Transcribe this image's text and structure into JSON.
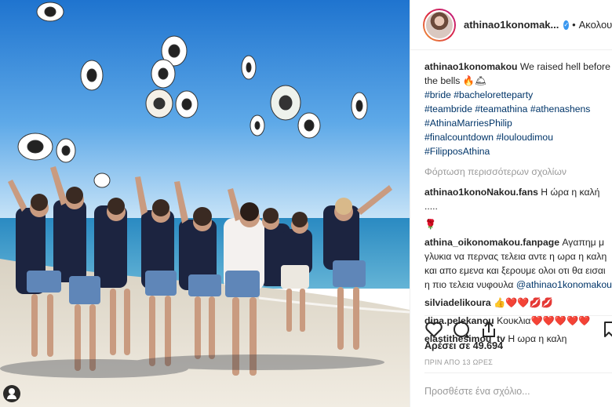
{
  "post": {
    "username": "athinao1konomak...",
    "follow_label": "Ακολουθε",
    "separator": "•",
    "verified_glyph": "✓"
  },
  "caption": {
    "username": "athinao1konomakou",
    "text": " We raised hell before the bells 🔥🛎",
    "hashtags": [
      "#bride #bachelorette­party",
      "#teambride #teamathina #athenashens",
      "#AthinaMarriesPhilip",
      "#finalcountdown #louloudimou",
      "#FilipposAthina"
    ]
  },
  "load_more": "Φόρτωση περισσότερων σχολίων",
  "comments": [
    {
      "user": "athinao1konoΝakou.fans",
      "text": " Η ώρα η καλή ....."
    },
    {
      "user": "",
      "text": "🌹"
    },
    {
      "user": "athina_oikonomakou.fanpage",
      "text": " Αγαπημ μ γλυκια να περνας τελεια αντε η ωρα η καλη και απο εμενα και ξερουμε ολοι οτι θα εισαι η πιο τελεια νυφουλα ",
      "mention": "@athinao1konomakou"
    },
    {
      "user": "silviadelikoura",
      "text": " 👍❤️❤️💋💋"
    },
    {
      "user": "dina.pelekanou",
      "text": " Κουκλια❤️❤️❤️❤️❤️"
    },
    {
      "user": "elastithesimou_tv",
      "text": " Η ωρα η καλη"
    }
  ],
  "likes": "Αρέσει σε 49.694",
  "timestamp": "ΠΡΙΝ ΑΠΟ 13 ΩΡΕΣ",
  "add_comment_placeholder": "Προσθέστε ένα σχόλιο...",
  "colors": {
    "sky_top": "#2a7fd6",
    "sky_bottom": "#bfe0f7",
    "sea": "#2f8ec2",
    "sand": "#e9e2d4",
    "link": "#003569"
  },
  "icons": [
    "user-tag-icon",
    "heart-icon",
    "comment-icon",
    "share-icon",
    "bookmark-icon",
    "verified-icon"
  ]
}
